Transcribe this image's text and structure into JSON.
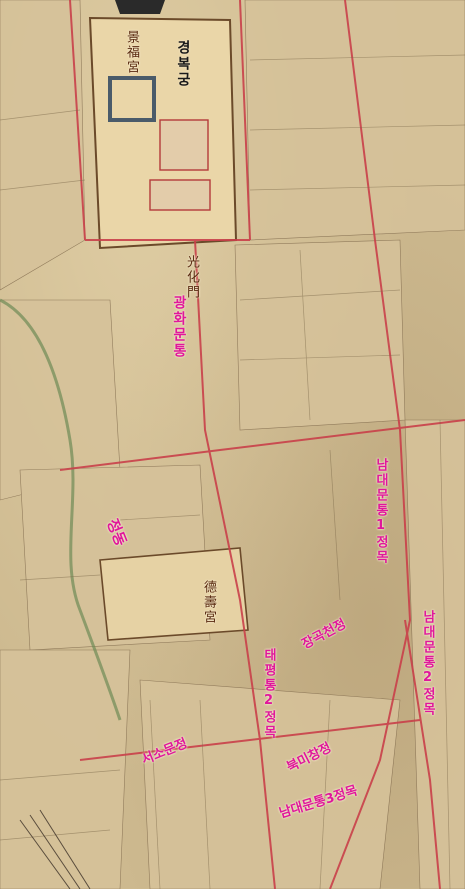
{
  "map": {
    "overlay_labels": {
      "gyeongbokgung": "경복궁",
      "gwanghwamun_tong": "광화문통",
      "namdaemun_tong_1": "남대문통1정목",
      "jeongdong": "정동",
      "namdaemun_tong_2": "남대문통2정목",
      "hasegawa_jeong": "장곡천정",
      "taepyeong_tong_2": "태평통2정목",
      "bukmichang_jeong": "북미창정",
      "seosomun_jeong": "서소문정",
      "namdaemun_tong_3": "남대문통3정목"
    },
    "base_labels": {
      "gyeongbok_han": "景福宮",
      "deoksu_han": "德壽宮",
      "gyeongbok_gate": "光化門"
    },
    "colors": {
      "paper": "#cdb98f",
      "overlay_text": "#e0179b",
      "road_red": "#c9404a",
      "ink": "#4a3a28",
      "block_fill": "#d9c79f",
      "landmark_fill": "#ead6a8"
    }
  }
}
